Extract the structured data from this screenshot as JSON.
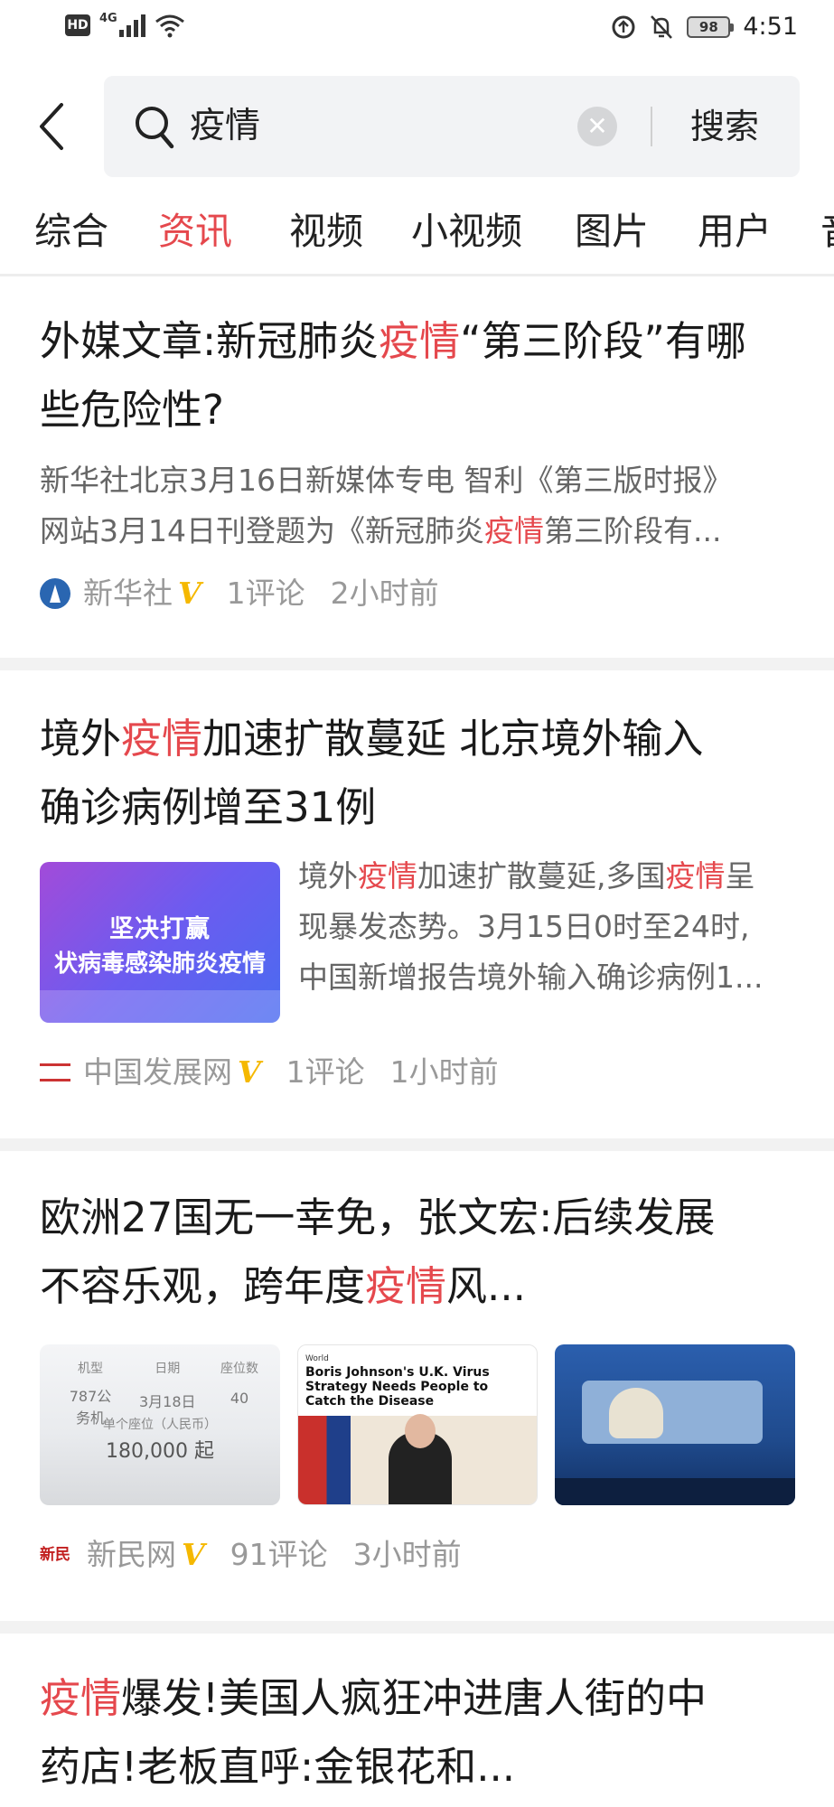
{
  "status_bar": {
    "hd": "HD",
    "network": "4G",
    "battery": "98",
    "time": "4:51"
  },
  "search": {
    "query": "疫情",
    "button": "搜索"
  },
  "tabs": [
    "综合",
    "资讯",
    "视频",
    "小视频",
    "图片",
    "用户",
    "音"
  ],
  "active_tab": "资讯",
  "articles": [
    {
      "title_parts": [
        "外媒文章:新冠肺炎",
        "疫情",
        "“第三阶段”有哪",
        "些危险性?"
      ],
      "abstract_line1": "新华社北京3月16日新媒体专电 智利《第三版时报》",
      "abstract_line2_parts": [
        "网站3月14日刊登题为《新冠肺炎",
        "疫情",
        "第三阶段有..."
      ],
      "source": "新华社",
      "verified": "V",
      "comments": "1评论",
      "time": "2小时前"
    },
    {
      "title_line1_parts": [
        "境外",
        "疫情",
        "加速扩散蔓延 北京境外输入"
      ],
      "title_line2": "确诊病例增至31例",
      "thumb_text1": "坚决打赢",
      "thumb_text2": "状病毒感染肺炎疫情",
      "abstract_line1_parts": [
        "境外",
        "疫情",
        "加速扩散蔓延,多国",
        "疫情",
        "呈"
      ],
      "abstract_line2": "现暴发态势。3月15日0时至24时,",
      "abstract_line3": "中国新增报告境外输入确诊病例1...",
      "source": "中国发展网",
      "verified": "V",
      "comments": "1评论",
      "time": "1小时前"
    },
    {
      "title_line1": "欧洲27国无一幸免，张文宏:后续发展",
      "title_line2_parts": [
        "不容乐观，跨年度",
        "疫情",
        "风..."
      ],
      "img1": {
        "c1_label": "机型",
        "c1_value": "787公务机",
        "c2_label": "日期",
        "c2_value": "3月18日",
        "c3_label": "座位数",
        "c3_value": "40",
        "price_label": "单个座位（人民币）",
        "price": "180,000 起"
      },
      "img2": {
        "section": "World",
        "headline": "Boris Johnson's U.K. Virus Strategy Needs People to Catch the Disease"
      },
      "source": "新民网",
      "source_logo_text": "新民",
      "verified": "V",
      "comments": "91评论",
      "time": "3小时前"
    },
    {
      "title_line1_parts": [
        "疫情",
        "爆发!美国人疯狂冲进唐人街的中"
      ],
      "title_line2": "药店!老板直呼:金银花和..."
    }
  ]
}
